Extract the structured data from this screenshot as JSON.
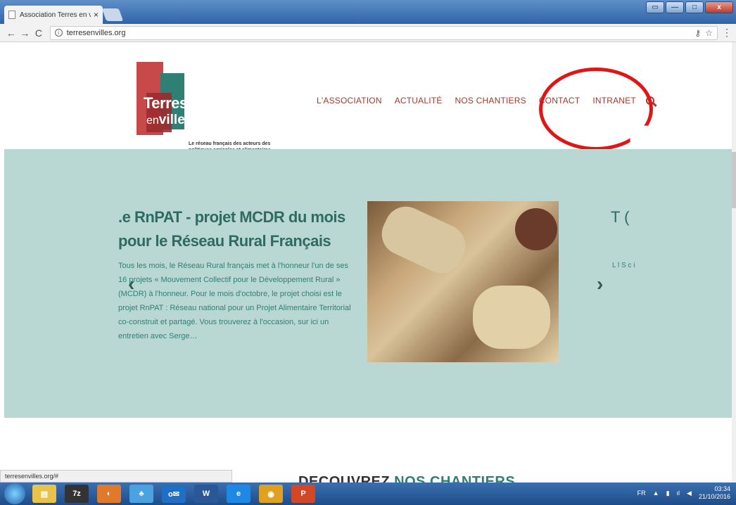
{
  "browser": {
    "tab_title": "Association Terres en vill",
    "tab_close": "×",
    "url": "terresenvilles.org"
  },
  "site": {
    "logo": {
      "line1": "Terres",
      "line2_small": "en",
      "line2_big": "villes",
      "tagline": "Le réseau français des acteurs des politiques agricoles et alimentaires d'agglomérations"
    },
    "nav": [
      "L'ASSOCIATION",
      "ACTUALITÉ",
      "NOS CHANTIERS",
      "CONTACT",
      "INTRANET"
    ],
    "slide": {
      "title": ".e RnPAT - projet MCDR du mois pour le Réseau Rural Français",
      "text": "Tous les mois, le Réseau Rural français met à l'honneur l'un de ses 16 projets « Mouvement Collectif pour le Développement Rural » (MCDR) à l'honneur. Pour le mois d'octobre, le projet choisi est le projet RnPAT : Réseau national pour un Projet Alimentaire Territorial co-construit et partagé. Vous trouverez à l'occasion, sur ici un entretien avec Serge…",
      "next_title": "T (",
      "next_text": "L l S c i"
    },
    "discover": {
      "part1": "DECOUVREZ ",
      "part2": "NOS CHANTIERS"
    }
  },
  "status_bar_url": "terresenvilles.org/#",
  "taskbar": {
    "apps": [
      "Explorer",
      "7z",
      "Chrome-alt",
      "Messenger",
      "Outlook",
      "Word",
      "IE",
      "Chrome",
      "PowerPoint"
    ],
    "lang": "FR",
    "time": "03:34",
    "date": "21/10/2016"
  },
  "colors": {
    "brand_red": "#9c3b2f",
    "teal": "#2f7f74",
    "slider_bg": "#b9d8d4",
    "annotation": "#e01515"
  }
}
